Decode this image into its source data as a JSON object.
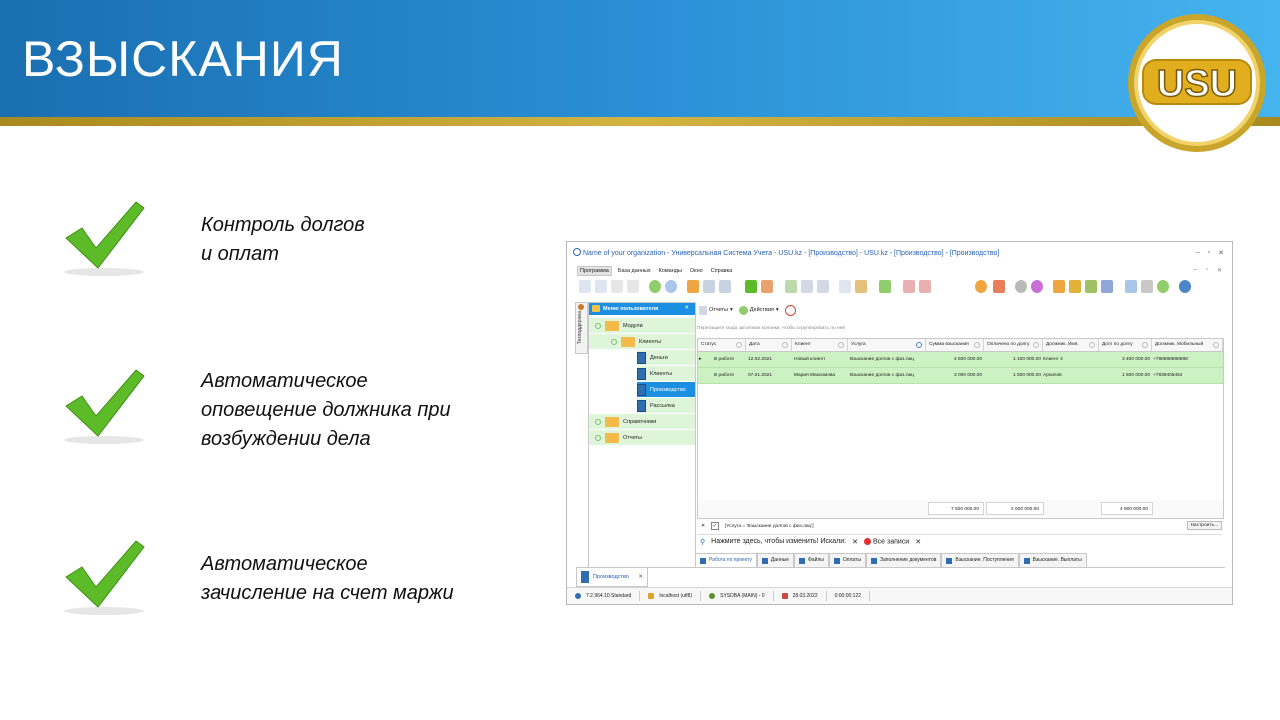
{
  "slide": {
    "title": "ВЗЫСКАНИЯ",
    "logo_text": "USU",
    "bullets": [
      {
        "text": "Контроль долгов\n и оплат"
      },
      {
        "text": "Автоматическое\nоповещение  должника при\nвозбуждении дела"
      },
      {
        "text": "Автоматическое\nзачисление  на счет маржи"
      }
    ],
    "colors": {
      "banner": "#2a8fd6",
      "gold": "#d2b443",
      "check": "#5dbb2a"
    }
  },
  "app": {
    "window_title": "Name of your organization - Универсальная Система Учета - USU.kz - [Производство] - USU.kz - [Производство] - [Производство]",
    "menu": [
      "Программа",
      "База данных",
      "Команды",
      "Окно",
      "Справка"
    ],
    "side_strip_label": "Техподдержка",
    "user_menu": {
      "title": "Меню пользователя",
      "items": [
        {
          "label": "Модули",
          "level": 0,
          "type": "folder"
        },
        {
          "label": "Клиенты",
          "level": 1,
          "type": "folder"
        },
        {
          "label": "Деньги",
          "level": 2,
          "type": "book"
        },
        {
          "label": "Клиенты",
          "level": 2,
          "type": "book"
        },
        {
          "label": "Производство",
          "level": 2,
          "type": "book",
          "selected": true
        },
        {
          "label": "Рассылка",
          "level": 2,
          "type": "book"
        },
        {
          "label": "Справочники",
          "level": 0,
          "type": "folder"
        },
        {
          "label": "Отчеты",
          "level": 0,
          "type": "folder"
        }
      ]
    },
    "content_toolbar": {
      "reports": "Отчеты",
      "actions": "Действия"
    },
    "group_hint": "Перетащите сюда заголовок колонки, чтобы сгруппировать по ней",
    "grid": {
      "columns": [
        "Статус",
        "Дата",
        "Клиент",
        "Услуга",
        "Сумма взыскания",
        "Оплачено по долгу",
        "Должник. Имя.",
        "Долг по долгу",
        "Должник. Мобильный"
      ],
      "rows": [
        [
          "В работе",
          "12.02.2021",
          "Новый клиент",
          "Взыскание долгов с физ.лиц",
          "4 500 000.00",
          "1 100 000.00",
          "Клиент 4",
          "3 400 000.00",
          "+788888888888"
        ],
        [
          "В работе",
          "07.01.2021",
          "Мария Максимова",
          "Взыскание долгов с физ.лиц",
          "3 000 000.00",
          "1 500 000.00",
          "Архипов",
          "1 500 000.00",
          "+7839405454"
        ]
      ],
      "totals": {
        "sum": "7 500 000.00",
        "paid": "2 600 000.00",
        "debt": "4 900 000.00"
      }
    },
    "filter": {
      "text": "[Услуга = 'Взыскание долгов с физ.лиц']",
      "configure": "Настроить..."
    },
    "search": {
      "prompt": "Нажмите здесь, чтобы изменить! Искали:",
      "all_records": "Все записи"
    },
    "subtabs": [
      "Работа по проекту",
      "Данные",
      "Файлы",
      "Оплаты",
      "Заполнение документов",
      "Взыскание. Поступления",
      "Взыскание. Выплаты"
    ],
    "doc_tab": "Производство",
    "status": {
      "version": "7.2.964.10 Standard",
      "db": "localhost (utf8)",
      "user": "SYSDBA (MAIN) - 0",
      "date": "28.03.2022",
      "timer": "0:00:00:122"
    }
  }
}
